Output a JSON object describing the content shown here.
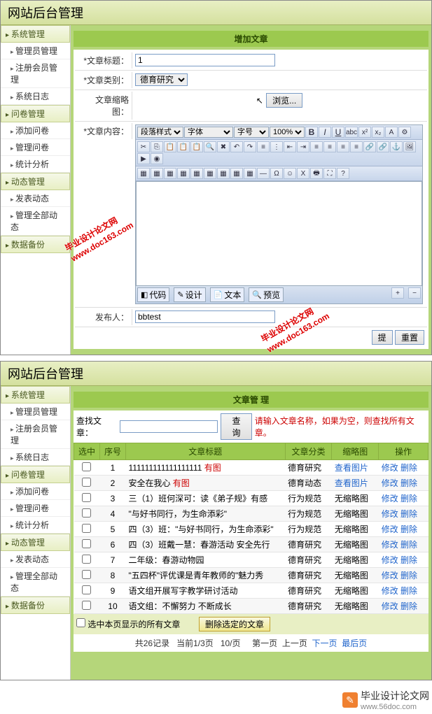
{
  "panel1": {
    "title": "网站后台管理",
    "header": "增加文章",
    "form": {
      "title_label": "*文章标题：",
      "title_value": "1",
      "cat_label": "*文章类别：",
      "cat_value": "德育研究",
      "thumb_label": "文章缩略图：",
      "browse_btn": "浏览...",
      "content_label": "*文章内容：",
      "publisher_label": "发布人：",
      "publisher_value": "bbtest",
      "submit": "提",
      "reset": "重置"
    },
    "editor": {
      "sel1": "段落样式",
      "sel2": "字体",
      "sel3": "字号",
      "sel4": "100%",
      "tabs": {
        "code": "代码",
        "design": "设计",
        "text": "文本",
        "preview": "预览"
      }
    }
  },
  "sidebar": {
    "groups": [
      {
        "label": "系统管理",
        "items": [
          "管理员管理",
          "注册会员管理",
          "系统日志"
        ]
      },
      {
        "label": "问卷管理",
        "items": [
          "添加问卷",
          "管理问卷",
          "统计分析"
        ]
      },
      {
        "label": "动态管理",
        "items": [
          "发表动态",
          "管理全部动态"
        ]
      },
      {
        "label": "数据备份",
        "items": []
      }
    ]
  },
  "panel2": {
    "title": "网站后台管理",
    "header": "文章管 理",
    "search": {
      "label": "查找文章：",
      "btn": "查 询",
      "tip": "请输入文章名称，如果为空，则查找所有文章。"
    },
    "cols": {
      "sel": "选中",
      "no": "序号",
      "title": "文章标题",
      "cat": "文章分类",
      "thumb": "缩略图",
      "ops": "操作"
    },
    "rows": [
      {
        "no": "1",
        "title": "111111111111111111",
        "img": "有图",
        "cat": "德育研究",
        "thumb": "查看图片"
      },
      {
        "no": "2",
        "title": "安全在我心",
        "img": "有图",
        "cat": "德育动态",
        "thumb": "查看图片"
      },
      {
        "no": "3",
        "title": "三（1）班何深可：读《弟子规》有感",
        "img": "",
        "cat": "行为规范",
        "thumb": "无缩略图"
      },
      {
        "no": "4",
        "title": "\"与好书同行，为生命添彩\"",
        "img": "",
        "cat": "行为规范",
        "thumb": "无缩略图"
      },
      {
        "no": "5",
        "title": "四（3）班：\"与好书同行，为生命添彩\"",
        "img": "",
        "cat": "行为规范",
        "thumb": "无缩略图"
      },
      {
        "no": "6",
        "title": "四（3）班戴一慧：春游活动 安全先行",
        "img": "",
        "cat": "德育研究",
        "thumb": "无缩略图"
      },
      {
        "no": "7",
        "title": "二年级：春游动物园",
        "img": "",
        "cat": "德育研究",
        "thumb": "无缩略图"
      },
      {
        "no": "8",
        "title": "\"五四杯\"评优课是青年教师的\"魅力秀",
        "img": "",
        "cat": "德育研究",
        "thumb": "无缩略图"
      },
      {
        "no": "9",
        "title": "语文组开展写字教学研讨活动",
        "img": "",
        "cat": "德育研究",
        "thumb": "无缩略图"
      },
      {
        "no": "10",
        "title": "语文组：不懈努力 不断成长",
        "img": "",
        "cat": "德育研究",
        "thumb": "无缩略图"
      }
    ],
    "ops": {
      "edit": "修改",
      "del": "删除"
    },
    "selall": "选中本页显示的所有文章",
    "delsel": "删除选定的文章",
    "pager": {
      "total": "共26记录",
      "cur": "当前1/3页",
      "per": "10/页",
      "first": "第一页",
      "prev": "上一页",
      "next": "下一页",
      "last": "最后页"
    }
  },
  "watermarks": {
    "text1": "毕业设计论文网",
    "url": "www.doc163.com",
    "footer": "毕业设计论文网",
    "footer_url": "www.56doc.com"
  }
}
